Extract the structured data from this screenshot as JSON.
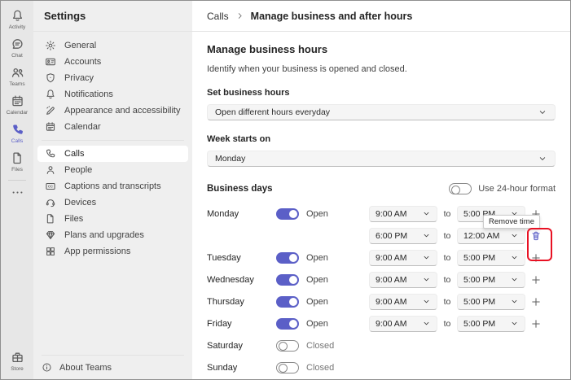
{
  "colors": {
    "accent": "#5b5fc7",
    "annotation_red": "#e81123"
  },
  "rail": {
    "items": [
      {
        "id": "activity",
        "icon": "bell",
        "label": "Activity",
        "active": false
      },
      {
        "id": "chat",
        "icon": "chat",
        "label": "Chat",
        "active": false
      },
      {
        "id": "teams",
        "icon": "people",
        "label": "Teams",
        "active": false
      },
      {
        "id": "calendar",
        "icon": "calendar",
        "label": "Calendar",
        "active": false
      },
      {
        "id": "calls",
        "icon": "phone",
        "label": "Calls",
        "active": true
      },
      {
        "id": "files",
        "icon": "file",
        "label": "Files",
        "active": false
      },
      {
        "id": "more",
        "icon": "more",
        "label": "",
        "active": false
      }
    ],
    "store": {
      "icon": "store",
      "label": "Store"
    }
  },
  "sidebar": {
    "title": "Settings",
    "items": [
      {
        "icon": "gear",
        "label": "General",
        "selected": false,
        "divider_after": false
      },
      {
        "icon": "id-card",
        "label": "Accounts",
        "selected": false,
        "divider_after": false
      },
      {
        "icon": "shield",
        "label": "Privacy",
        "selected": false,
        "divider_after": false
      },
      {
        "icon": "bell",
        "label": "Notifications",
        "selected": false,
        "divider_after": false
      },
      {
        "icon": "pen",
        "label": "Appearance and accessibility",
        "selected": false,
        "divider_after": false
      },
      {
        "icon": "calendar",
        "label": "Calendar",
        "selected": false,
        "divider_after": true
      },
      {
        "icon": "phone",
        "label": "Calls",
        "selected": true,
        "divider_after": false
      },
      {
        "icon": "person",
        "label": "People",
        "selected": false,
        "divider_after": false
      },
      {
        "icon": "cc",
        "label": "Captions and transcripts",
        "selected": false,
        "divider_after": false
      },
      {
        "icon": "headset",
        "label": "Devices",
        "selected": false,
        "divider_after": false
      },
      {
        "icon": "file",
        "label": "Files",
        "selected": false,
        "divider_after": false
      },
      {
        "icon": "diamond",
        "label": "Plans and upgrades",
        "selected": false,
        "divider_after": false
      },
      {
        "icon": "apps",
        "label": "App permissions",
        "selected": false,
        "divider_after": false
      }
    ],
    "footer": {
      "icon": "info",
      "label": "About Teams"
    }
  },
  "header": {
    "breadcrumb_parent": "Calls",
    "breadcrumb_current": "Manage business and after hours"
  },
  "content": {
    "title": "Manage business hours",
    "description": "Identify when your business is opened and closed.",
    "set_hours_label": "Set business hours",
    "set_hours_value": "Open different hours everyday",
    "week_starts_label": "Week starts on",
    "week_starts_value": "Monday",
    "business_days_label": "Business days",
    "format_toggle_label": "Use 24-hour format",
    "format_toggle_on": false,
    "open_label": "Open",
    "closed_label": "Closed",
    "to_label": "to",
    "tooltip": "Remove time",
    "days": [
      {
        "name": "Monday",
        "open": true,
        "slots": [
          {
            "from": "9:00 AM",
            "to": "5:00 PM",
            "action": "add"
          },
          {
            "from": "6:00 PM",
            "to": "12:00 AM",
            "action": "remove"
          }
        ]
      },
      {
        "name": "Tuesday",
        "open": true,
        "slots": [
          {
            "from": "9:00 AM",
            "to": "5:00 PM",
            "action": "add"
          }
        ]
      },
      {
        "name": "Wednesday",
        "open": true,
        "slots": [
          {
            "from": "9:00 AM",
            "to": "5:00 PM",
            "action": "add"
          }
        ]
      },
      {
        "name": "Thursday",
        "open": true,
        "slots": [
          {
            "from": "9:00 AM",
            "to": "5:00 PM",
            "action": "add"
          }
        ]
      },
      {
        "name": "Friday",
        "open": true,
        "slots": [
          {
            "from": "9:00 AM",
            "to": "5:00 PM",
            "action": "add"
          }
        ]
      },
      {
        "name": "Saturday",
        "open": false,
        "slots": []
      },
      {
        "name": "Sunday",
        "open": false,
        "slots": []
      }
    ]
  }
}
